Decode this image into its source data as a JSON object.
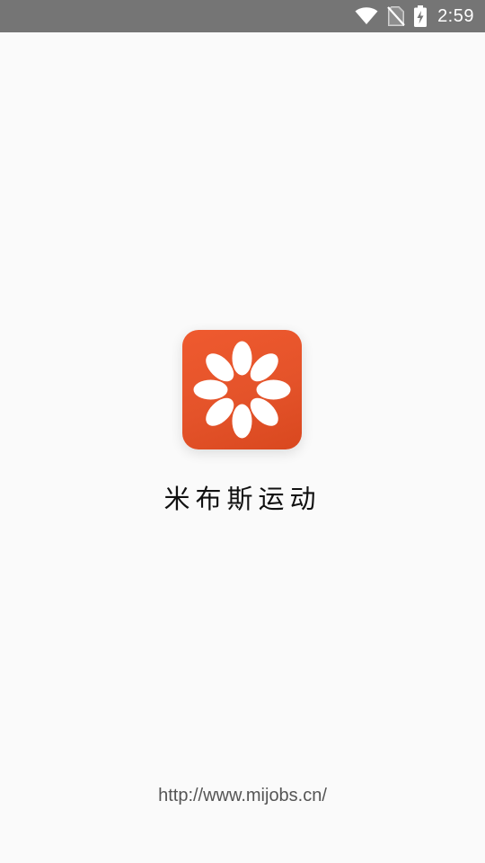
{
  "status_bar": {
    "time": "2:59",
    "icons": [
      "wifi-icon",
      "no-sim-icon",
      "battery-charging-icon"
    ]
  },
  "app": {
    "name": "米布斯运动",
    "logo_icon": "flower-logo-icon",
    "website": "http://www.mijobs.cn/"
  },
  "colors": {
    "status_bar": "#757575",
    "background": "#fafafa",
    "logo_orange": "#e4532a",
    "petal": "#ffffff"
  }
}
